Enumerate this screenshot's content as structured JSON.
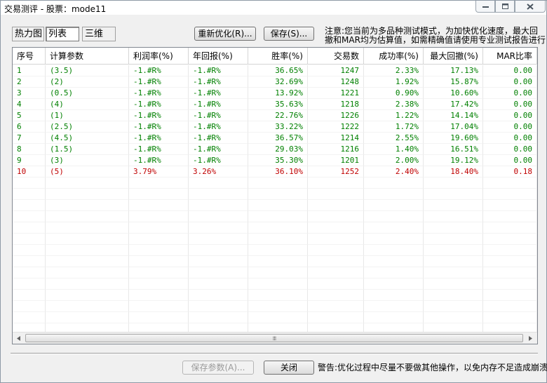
{
  "window": {
    "title": "交易测评 - 股票：mode11"
  },
  "tabs": [
    {
      "label": "热力图"
    },
    {
      "label": "列表"
    },
    {
      "label": "三维"
    }
  ],
  "toolbar": {
    "reoptimize_label": "重新优化(R)...",
    "save_label": "保存(S)..."
  },
  "notice": {
    "line1": "注意:您当前为多品种测试模式，为加快优化速度，最大回",
    "line2": "撤和MAR均为估算值，如需精确值请使用专业测试报告进行"
  },
  "table": {
    "columns": [
      "序号",
      "计算参数",
      "利润率(%)",
      "年回报(%)",
      "胜率(%)",
      "交易数",
      "成功率(%)",
      "最大回撤(%)",
      "MAR比率"
    ],
    "rows": [
      {
        "id": "1",
        "param": "(3.5)",
        "profit": "-1.#R%",
        "annual": "-1.#R%",
        "win": "36.65%",
        "trades": "1247",
        "success": "2.33%",
        "drawdown": "17.13%",
        "mar": "0.00",
        "color": "green"
      },
      {
        "id": "2",
        "param": "(2)",
        "profit": "-1.#R%",
        "annual": "-1.#R%",
        "win": "32.69%",
        "trades": "1248",
        "success": "1.92%",
        "drawdown": "15.87%",
        "mar": "0.00",
        "color": "green"
      },
      {
        "id": "3",
        "param": "(0.5)",
        "profit": "-1.#R%",
        "annual": "-1.#R%",
        "win": "13.92%",
        "trades": "1221",
        "success": "0.90%",
        "drawdown": "10.60%",
        "mar": "0.00",
        "color": "green"
      },
      {
        "id": "4",
        "param": "(4)",
        "profit": "-1.#R%",
        "annual": "-1.#R%",
        "win": "35.63%",
        "trades": "1218",
        "success": "2.38%",
        "drawdown": "17.42%",
        "mar": "0.00",
        "color": "green"
      },
      {
        "id": "5",
        "param": "(1)",
        "profit": "-1.#R%",
        "annual": "-1.#R%",
        "win": "22.76%",
        "trades": "1226",
        "success": "1.22%",
        "drawdown": "14.14%",
        "mar": "0.00",
        "color": "green"
      },
      {
        "id": "6",
        "param": "(2.5)",
        "profit": "-1.#R%",
        "annual": "-1.#R%",
        "win": "33.22%",
        "trades": "1222",
        "success": "1.72%",
        "drawdown": "17.04%",
        "mar": "0.00",
        "color": "green"
      },
      {
        "id": "7",
        "param": "(4.5)",
        "profit": "-1.#R%",
        "annual": "-1.#R%",
        "win": "36.57%",
        "trades": "1214",
        "success": "2.55%",
        "drawdown": "19.60%",
        "mar": "0.00",
        "color": "green"
      },
      {
        "id": "8",
        "param": "(1.5)",
        "profit": "-1.#R%",
        "annual": "-1.#R%",
        "win": "29.03%",
        "trades": "1216",
        "success": "1.40%",
        "drawdown": "16.51%",
        "mar": "0.00",
        "color": "green"
      },
      {
        "id": "9",
        "param": "(3)",
        "profit": "-1.#R%",
        "annual": "-1.#R%",
        "win": "35.30%",
        "trades": "1201",
        "success": "2.00%",
        "drawdown": "19.12%",
        "mar": "0.00",
        "color": "green"
      },
      {
        "id": "10",
        "param": "(5)",
        "profit": "3.79%",
        "annual": "3.26%",
        "win": "36.10%",
        "trades": "1252",
        "success": "2.40%",
        "drawdown": "18.40%",
        "mar": "0.18",
        "color": "red"
      }
    ]
  },
  "footer": {
    "save_params_label": "保存参数(A)...",
    "close_label": "关闭",
    "warning": "警告:优化过程中尽量不要做其他操作，以免内存不足造成崩溃"
  },
  "colors": {
    "green": "#008000",
    "red": "#c00000"
  },
  "icons": [
    "minimize-icon",
    "maximize-icon",
    "close-icon",
    "arrow-left-icon",
    "arrow-right-icon",
    "scroll-grip-icon"
  ]
}
